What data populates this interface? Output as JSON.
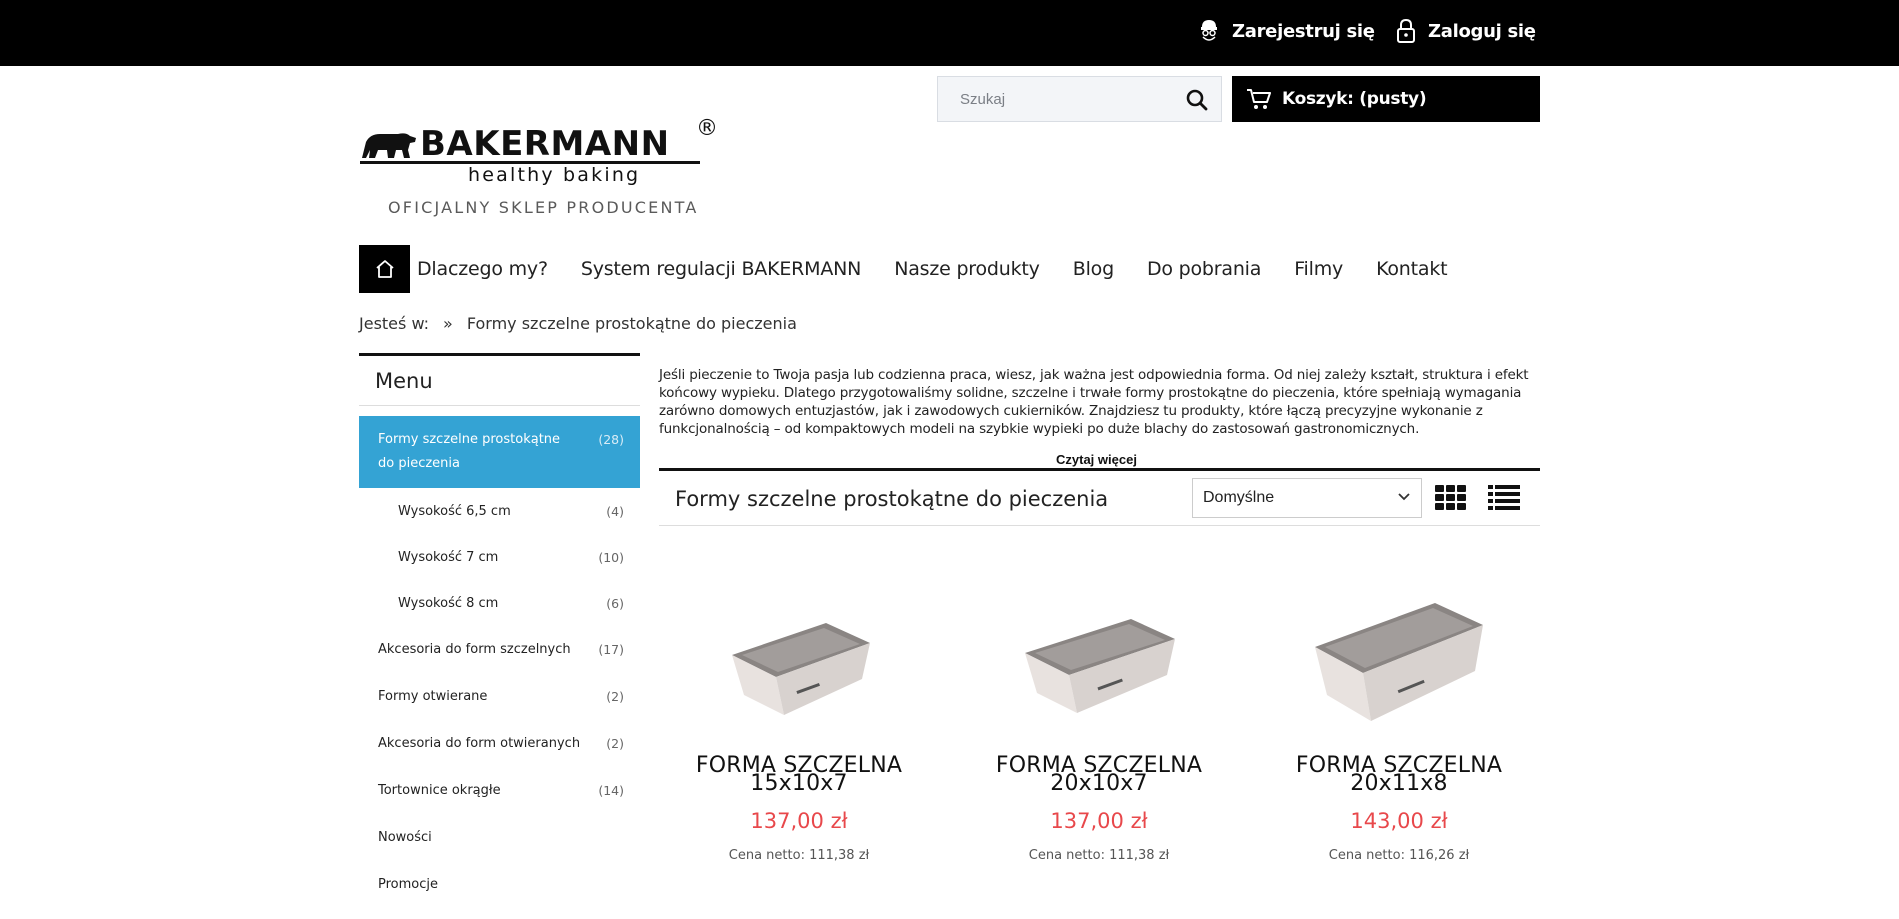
{
  "topbar": {
    "register_label": "Zarejestruj się",
    "login_label": "Zaloguj się"
  },
  "search": {
    "placeholder": "Szukaj"
  },
  "cart": {
    "label": "Koszyk: (pusty)"
  },
  "logo": {
    "brand": "BAKERMANN",
    "registered": "®",
    "tagline": "healthy baking",
    "official": "OFICJALNY SKLEP PRODUCENTA"
  },
  "nav": {
    "items": [
      "Dlaczego my?",
      "System regulacji BAKERMANN",
      "Nasze produkty",
      "Blog",
      "Do pobrania",
      "Filmy",
      "Kontakt"
    ]
  },
  "breadcrumb": {
    "prefix": "Jesteś w:",
    "separator": "»",
    "current": "Formy szczelne prostokątne do pieczenia"
  },
  "sidebar": {
    "title": "Menu",
    "items": [
      {
        "label": "Formy szczelne prostokątne do pieczenia",
        "count": "(28)"
      },
      {
        "label": "Wysokość 6,5 cm",
        "count": "(4)"
      },
      {
        "label": "Wysokość 7 cm",
        "count": "(10)"
      },
      {
        "label": "Wysokość 8 cm",
        "count": "(6)"
      },
      {
        "label": "Akcesoria do form szczelnych",
        "count": "(17)"
      },
      {
        "label": "Formy otwierane",
        "count": "(2)"
      },
      {
        "label": "Akcesoria do form otwieranych",
        "count": "(2)"
      },
      {
        "label": "Tortownice okrągłe",
        "count": "(14)"
      },
      {
        "label": "Nowości",
        "count": ""
      },
      {
        "label": "Promocje",
        "count": ""
      }
    ]
  },
  "description": {
    "text": "Jeśli pieczenie to Twoja pasja lub codzienna praca, wiesz, jak ważna jest odpowiednia forma. Od niej zależy kształt, struktura i efekt końcowy wypieku. Dlatego przygotowaliśmy solidne, szczelne i trwałe formy prostokątne do pieczenia, które spełniają wymagania zarówno domowych entuzjastów, jak i zawodowych cukierników. Znajdziesz tu produkty, które łączą precyzyjne wykonanie z funkcjonalnością – od kompaktowych modeli na szybkie wypieki po duże blachy do zastosowań gastronomicznych.",
    "read_more": "Czytaj więcej"
  },
  "category": {
    "title": "Formy szczelne prostokątne do pieczenia",
    "sort_selected": "Domyślne"
  },
  "products": [
    {
      "name_line1": "FORMA SZCZELNA",
      "name_line2": "15x10x7",
      "price": "137,00 zł",
      "net": "Cena netto: 111,38 zł"
    },
    {
      "name_line1": "FORMA SZCZELNA",
      "name_line2": "20x10x7",
      "price": "137,00 zł",
      "net": "Cena netto: 111,38 zł"
    },
    {
      "name_line1": "FORMA SZCZELNA",
      "name_line2": "20x11x8",
      "price": "143,00 zł",
      "net": "Cena netto: 116,26 zł"
    }
  ],
  "colors": {
    "accent": "#34a3d4",
    "price": "#e8484b",
    "topbar": "#000000"
  }
}
